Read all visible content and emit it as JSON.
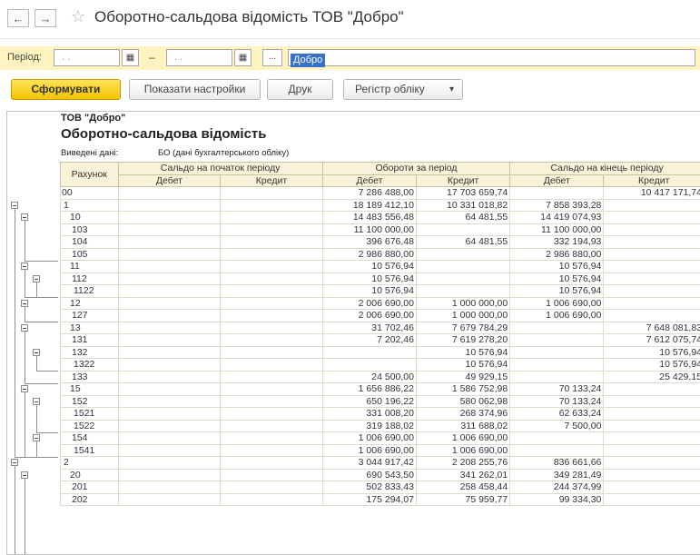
{
  "window": {
    "title": "Оборотно-сальдова відомість  ТОВ \"Добро\"",
    "back_glyph": "←",
    "forward_glyph": "→",
    "favorite_glyph": "☆"
  },
  "period": {
    "label": "Період:",
    "from_value": ". .",
    "to_value": ". .",
    "dash": "–",
    "calendar_glyph": "▦",
    "dots_label": "...",
    "organization": "Добро"
  },
  "toolbar": {
    "generate_label": "Сформувати",
    "settings_label": "Показати настройки",
    "print_label": "Друк",
    "register_label": "Регістр обліку",
    "dropdown_glyph": "▾"
  },
  "report": {
    "company": "ТОВ \"Добро\"",
    "title": "Оборотно-сальдова відомість",
    "output_label": "Виведені дані:",
    "output_value": "БО (дані бухгалтерського обліку)",
    "headers": {
      "account": "Рахунок",
      "opening": "Сальдо на початок періоду",
      "turnover": "Обороти за період",
      "closing": "Сальдо на кінець періоду",
      "debit": "Дебет",
      "credit": "Кредит"
    },
    "rows": [
      {
        "acc": "00",
        "od": "",
        "oc": "",
        "td": "7 286 488,00",
        "tc": "17 703 659,74",
        "cd": "",
        "cc": "10 417 171,74"
      },
      {
        "acc": "1",
        "od": "",
        "oc": "",
        "td": "18 189 412,10",
        "tc": "10 331 018,82",
        "cd": "7 858 393,28",
        "cc": ""
      },
      {
        "acc": "10",
        "od": "",
        "oc": "",
        "td": "14 483 556,48",
        "tc": "64 481,55",
        "cd": "14 419 074,93",
        "cc": ""
      },
      {
        "acc": "103",
        "od": "",
        "oc": "",
        "td": "11 100 000,00",
        "tc": "",
        "cd": "11 100 000,00",
        "cc": ""
      },
      {
        "acc": "104",
        "od": "",
        "oc": "",
        "td": "396 676,48",
        "tc": "64 481,55",
        "cd": "332 194,93",
        "cc": ""
      },
      {
        "acc": "105",
        "od": "",
        "oc": "",
        "td": "2 986 880,00",
        "tc": "",
        "cd": "2 986 880,00",
        "cc": ""
      },
      {
        "acc": "11",
        "od": "",
        "oc": "",
        "td": "10 576,94",
        "tc": "",
        "cd": "10 576,94",
        "cc": ""
      },
      {
        "acc": "112",
        "od": "",
        "oc": "",
        "td": "10 576,94",
        "tc": "",
        "cd": "10 576,94",
        "cc": ""
      },
      {
        "acc": "1122",
        "od": "",
        "oc": "",
        "td": "10 576,94",
        "tc": "",
        "cd": "10 576,94",
        "cc": ""
      },
      {
        "acc": "12",
        "od": "",
        "oc": "",
        "td": "2 006 690,00",
        "tc": "1 000 000,00",
        "cd": "1 006 690,00",
        "cc": ""
      },
      {
        "acc": "127",
        "od": "",
        "oc": "",
        "td": "2 006 690,00",
        "tc": "1 000 000,00",
        "cd": "1 006 690,00",
        "cc": ""
      },
      {
        "acc": "13",
        "od": "",
        "oc": "",
        "td": "31 702,46",
        "tc": "7 679 784,29",
        "cd": "",
        "cc": "7 648 081,83"
      },
      {
        "acc": "131",
        "od": "",
        "oc": "",
        "td": "7 202,46",
        "tc": "7 619 278,20",
        "cd": "",
        "cc": "7 612 075,74"
      },
      {
        "acc": "132",
        "od": "",
        "oc": "",
        "td": "",
        "tc": "10 576,94",
        "cd": "",
        "cc": "10 576,94"
      },
      {
        "acc": "1322",
        "od": "",
        "oc": "",
        "td": "",
        "tc": "10 576,94",
        "cd": "",
        "cc": "10 576,94"
      },
      {
        "acc": "133",
        "od": "",
        "oc": "",
        "td": "24 500,00",
        "tc": "49 929,15",
        "cd": "",
        "cc": "25 429,15"
      },
      {
        "acc": "15",
        "od": "",
        "oc": "",
        "td": "1 656 886,22",
        "tc": "1 586 752,98",
        "cd": "70 133,24",
        "cc": ""
      },
      {
        "acc": "152",
        "od": "",
        "oc": "",
        "td": "650 196,22",
        "tc": "580 062,98",
        "cd": "70 133,24",
        "cc": ""
      },
      {
        "acc": "1521",
        "od": "",
        "oc": "",
        "td": "331 008,20",
        "tc": "268 374,96",
        "cd": "62 633,24",
        "cc": ""
      },
      {
        "acc": "1522",
        "od": "",
        "oc": "",
        "td": "319 188,02",
        "tc": "311 688,02",
        "cd": "7 500,00",
        "cc": ""
      },
      {
        "acc": "154",
        "od": "",
        "oc": "",
        "td": "1 006 690,00",
        "tc": "1 006 690,00",
        "cd": "",
        "cc": ""
      },
      {
        "acc": "1541",
        "od": "",
        "oc": "",
        "td": "1 006 690,00",
        "tc": "1 006 690,00",
        "cd": "",
        "cc": ""
      },
      {
        "acc": "2",
        "od": "",
        "oc": "",
        "td": "3 044 917,42",
        "tc": "2 208 255,76",
        "cd": "836 661,66",
        "cc": ""
      },
      {
        "acc": "20",
        "od": "",
        "oc": "",
        "td": "690 543,50",
        "tc": "341 262,01",
        "cd": "349 281,49",
        "cc": ""
      },
      {
        "acc": "201",
        "od": "",
        "oc": "",
        "td": "502 833,43",
        "tc": "258 458,44",
        "cd": "244 374,99",
        "cc": ""
      },
      {
        "acc": "202",
        "od": "",
        "oc": "",
        "td": "175 294,07",
        "tc": "75 959,77",
        "cd": "99 334,30",
        "cc": ""
      }
    ]
  }
}
